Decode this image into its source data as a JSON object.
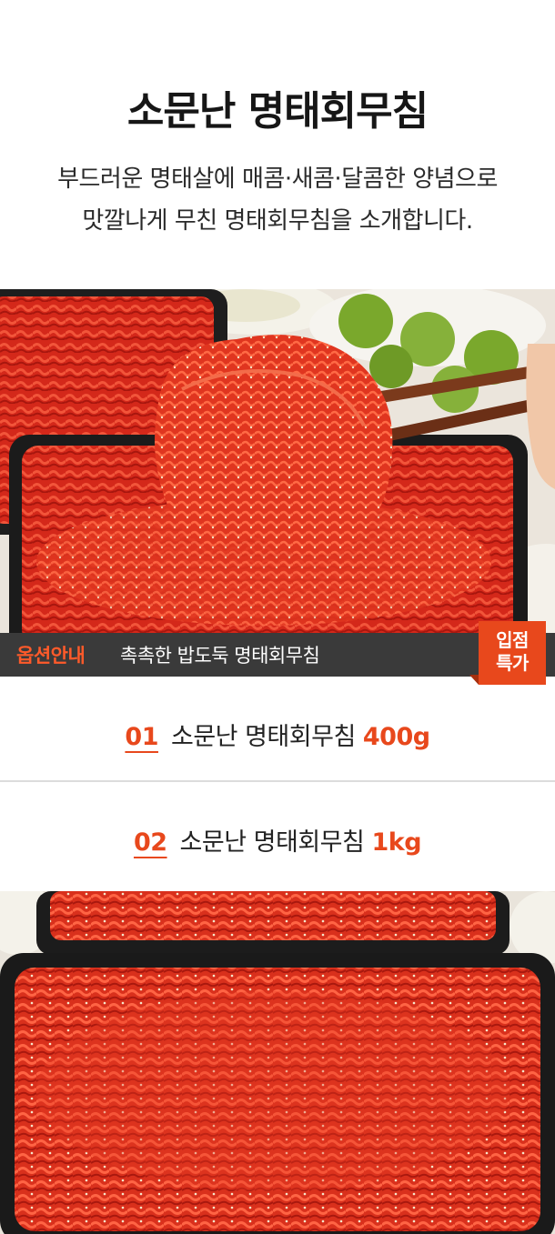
{
  "header": {
    "title": "소문난 명태회무침",
    "description_line1": "부드러운 명태살에 매콤·새콤·달콤한 양념으로",
    "description_line2": "맛깔나게 무친 명태회무침을 소개합니다."
  },
  "option_bar": {
    "label": "옵션안내",
    "text": "촉촉한 밥도둑 명태회무침"
  },
  "badge": {
    "line1": "입점",
    "line2": "특가"
  },
  "options": [
    {
      "number": "01",
      "name": "소문난 명태회무침",
      "amount": "400g"
    },
    {
      "number": "02",
      "name": "소문난 명태회무침",
      "amount": "1kg"
    }
  ],
  "images": [
    {
      "name": "명태회무침 젓가락 사진"
    },
    {
      "name": "명태회무침 용기 사진"
    }
  ],
  "colors": {
    "accent": "#e8481c",
    "bar": "#3a3a3a",
    "food_red": "#d92a1c"
  }
}
